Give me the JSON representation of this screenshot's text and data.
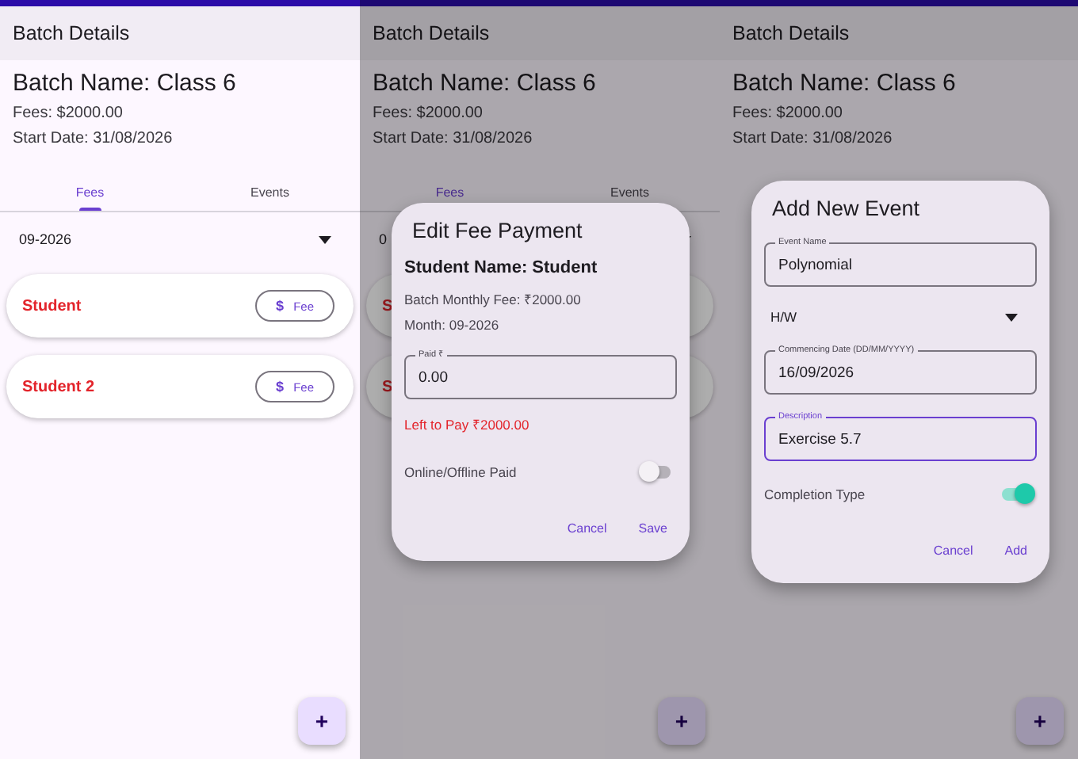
{
  "screens": [
    {
      "header": "Batch Details",
      "batch_name": "Batch Name: Class 6",
      "fees": "Fees: $2000.00",
      "start_date": "Start Date: 31/08/2026",
      "dimmed": false,
      "tabs": [
        {
          "label": "Fees",
          "selected": true
        },
        {
          "label": "Events",
          "selected": false
        }
      ],
      "month_dropdown": "09-2026",
      "students": [
        {
          "name": "Student",
          "button_icon": "$",
          "button": "Fee"
        },
        {
          "name": "Student 2",
          "button_icon": "$",
          "button": "Fee"
        }
      ],
      "fab": "+"
    },
    {
      "header": "Batch Details",
      "batch_name": "Batch Name: Class 6",
      "fees": "Fees: $2000.00",
      "start_date": "Start Date: 31/08/2026",
      "dimmed": true,
      "tabs": [
        {
          "label": "Fees",
          "selected": true
        },
        {
          "label": "Events",
          "selected": false
        }
      ],
      "month_dropdown": "0",
      "students": [
        {
          "name": "S"
        },
        {
          "name": "S"
        }
      ],
      "fab": "+",
      "dialog": {
        "title": "Edit Fee Payment",
        "kind": "fee",
        "items": [
          {
            "kind": "heading",
            "text": "Student Name: Student"
          },
          {
            "kind": "text",
            "text": "Batch Monthly Fee: ₹2000.00"
          },
          {
            "kind": "text",
            "text": "Month: 09-2026"
          },
          {
            "kind": "field",
            "label": "Paid ₹",
            "value": "0.00",
            "focused": false
          },
          {
            "kind": "error",
            "text": "Left to Pay ₹2000.00"
          },
          {
            "kind": "switch",
            "label": "Online/Offline Paid",
            "on": false
          }
        ],
        "actions": [
          "Cancel",
          "Save"
        ]
      }
    },
    {
      "header": "Batch Details",
      "batch_name": "Batch Name: Class 6",
      "fees": "Fees: $2000.00",
      "start_date": "Start Date: 31/08/2026",
      "dimmed": true,
      "fab": "+",
      "dialog": {
        "title": "Add New Event",
        "kind": "event",
        "items": [
          {
            "kind": "field",
            "label": "Event Name",
            "value": "Polynomial",
            "focused": false
          },
          {
            "kind": "dropdown",
            "value": "H/W"
          },
          {
            "kind": "field",
            "label": "Commencing Date (DD/MM/YYYY)",
            "value": "16/09/2026",
            "focused": false
          },
          {
            "kind": "field",
            "label": "Description",
            "value": "Exercise 5.7",
            "focused": true
          },
          {
            "kind": "switch",
            "label": "Completion Type",
            "on": true
          }
        ],
        "actions": [
          "Cancel",
          "Add"
        ]
      }
    }
  ]
}
